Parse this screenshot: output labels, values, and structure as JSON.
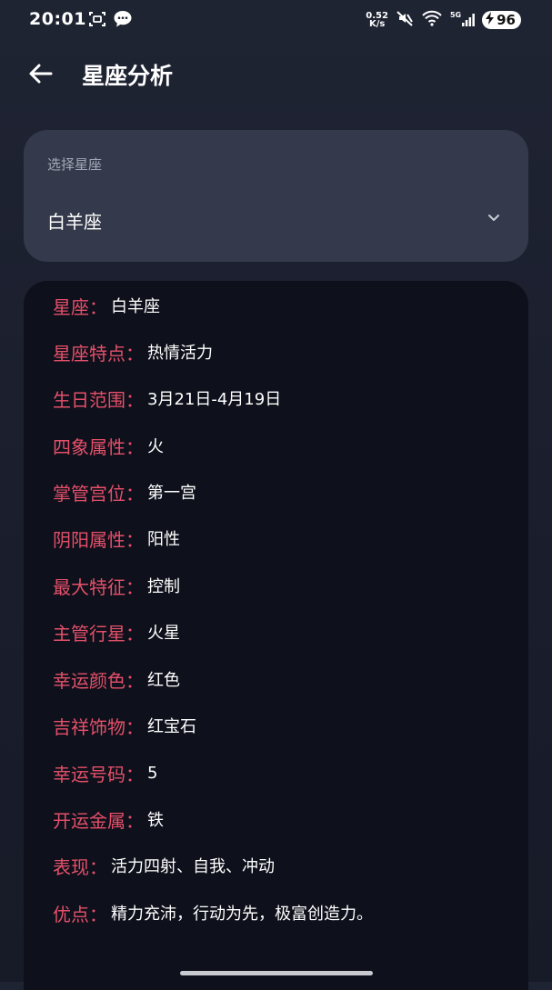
{
  "status_bar": {
    "time": "20:01",
    "net_speed_value": "0.52",
    "net_speed_unit": "K/s",
    "network": "5G",
    "battery": "96"
  },
  "app_bar": {
    "title": "星座分析"
  },
  "selector": {
    "label": "选择星座",
    "value": "白羊座"
  },
  "details": [
    {
      "key": "星座：",
      "value": "白羊座"
    },
    {
      "key": "星座特点：",
      "value": "热情活力"
    },
    {
      "key": "生日范围：",
      "value": "3月21日-4月19日"
    },
    {
      "key": "四象属性：",
      "value": "火"
    },
    {
      "key": "掌管宫位：",
      "value": "第一宫"
    },
    {
      "key": "阴阳属性：",
      "value": "阳性"
    },
    {
      "key": "最大特征：",
      "value": "控制"
    },
    {
      "key": "主管行星：",
      "value": "火星"
    },
    {
      "key": "幸运颜色：",
      "value": "红色"
    },
    {
      "key": "吉祥饰物：",
      "value": "红宝石"
    },
    {
      "key": "幸运号码：",
      "value": "5"
    },
    {
      "key": "开运金属：",
      "value": "铁"
    },
    {
      "key": "表现：",
      "value": "活力四射、自我、冲动"
    },
    {
      "key": "优点：",
      "value": "精力充沛，行动为先，极富创造力。"
    }
  ],
  "colors": {
    "accent": "#e4506a",
    "background": "#1d2130",
    "card": "#343a4b",
    "panel": "#0e101b"
  }
}
